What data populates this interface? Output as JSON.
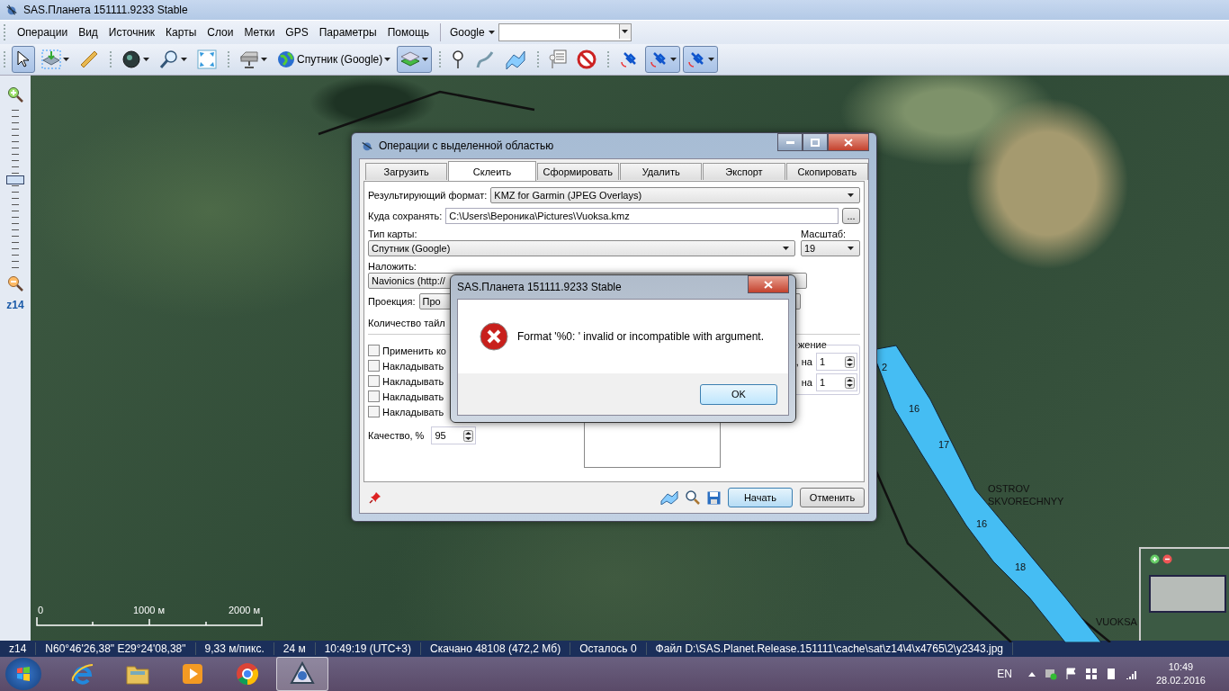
{
  "app_window": {
    "title": "SAS.Планета 151111.9233 Stable"
  },
  "menu": [
    "Операции",
    "Вид",
    "Источник",
    "Карты",
    "Слои",
    "Метки",
    "GPS",
    "Параметры",
    "Помощь"
  ],
  "search": {
    "provider": "Google"
  },
  "toolbar": {
    "groups": [
      [
        {
          "kind": "pointer",
          "selected": true,
          "dropdown": false
        },
        {
          "kind": "add-layer",
          "selected": false,
          "dropdown": true
        },
        {
          "kind": "ruler",
          "selected": false,
          "dropdown": false
        }
      ],
      [
        {
          "kind": "globe",
          "selected": false,
          "dropdown": true
        },
        {
          "kind": "magnifier",
          "selected": false,
          "dropdown": true
        },
        {
          "kind": "fullscreen",
          "selected": false,
          "dropdown": false
        }
      ],
      [
        {
          "kind": "drive",
          "selected": false,
          "dropdown": true
        },
        {
          "kind": "source",
          "label": "Спутник (Google)",
          "selected": false,
          "dropdown": true
        },
        {
          "kind": "layers",
          "selected": true,
          "dropdown": true
        }
      ],
      [
        {
          "kind": "pin",
          "selected": false,
          "dropdown": false
        },
        {
          "kind": "path",
          "selected": false,
          "dropdown": false
        },
        {
          "kind": "polygon",
          "selected": false,
          "dropdown": false
        }
      ],
      [
        {
          "kind": "marks-list",
          "selected": false,
          "dropdown": false
        },
        {
          "kind": "no-marks",
          "selected": false,
          "dropdown": false
        }
      ],
      [
        {
          "kind": "gps",
          "selected": false,
          "dropdown": false
        },
        {
          "kind": "gps",
          "selected": true,
          "dropdown": true
        },
        {
          "kind": "gps",
          "selected": true,
          "dropdown": true
        }
      ]
    ]
  },
  "zoom_bar": {
    "level": 0.55,
    "zoom_label": "z14"
  },
  "map": {
    "scale_labels": [
      "0",
      "1000 м",
      "2000 м"
    ],
    "place_labels": [
      "OSTROV SKVORECHNYY",
      "VUOKSA"
    ],
    "depth_marks": [
      "2",
      "16",
      "17",
      "16",
      "18"
    ]
  },
  "dialog": {
    "title": "Операции с выделенной областью",
    "tabs": [
      {
        "label": "Загрузить",
        "selected": false
      },
      {
        "label": "Склеить",
        "selected": true
      },
      {
        "label": "Сформировать",
        "selected": false
      },
      {
        "label": "Удалить",
        "selected": false
      },
      {
        "label": "Экспорт",
        "selected": false
      },
      {
        "label": "Скопировать",
        "selected": false
      }
    ],
    "format_label": "Результирующий формат:",
    "format_value": "KMZ for Garmin (JPEG Overlays)",
    "path_label": "Куда сохранять:",
    "path_value": "C:\\Users\\Вероника\\Pictures\\Vuoksa.kmz",
    "browse_button": "...",
    "map_type_label": "Тип карты:",
    "map_type_value": "Спутник (Google)",
    "scale_label": "Масштаб:",
    "scale_value": "19",
    "overlay_label": "Наложить:",
    "overlay_value": "Navionics (http://",
    "projection_label": "Проекция:",
    "projection_value": "Про",
    "tiles_label": "Количество тайл",
    "checkboxes": [
      {
        "label": "Применить ко",
        "checked": false
      },
      {
        "label": "Накладывать",
        "checked": false
      },
      {
        "label": "Накладывать",
        "checked": false
      },
      {
        "label": "Накладывать",
        "checked": false
      },
      {
        "label": "Накладывать",
        "checked": false
      }
    ],
    "quality_label": "Качество, %",
    "quality_value": "95",
    "split_group": {
      "title": "жение",
      "rows": [
        {
          "label": ", на",
          "value": "1"
        },
        {
          "label": "на",
          "value": "1"
        }
      ]
    },
    "start_button": "Начать",
    "cancel_button": "Отменить"
  },
  "message_box": {
    "title": "SAS.Планета 151111.9233 Stable",
    "text": "Format '%0: ' invalid or incompatible with argument.",
    "ok_button": "OK"
  },
  "status_bar": [
    "z14",
    "N60°46'26,38\" E29°24'08,38\"",
    "9,33 м/пикс.",
    "24 м",
    "10:49:19 (UTC+3)",
    "Скачано 48108 (472,2 Мб)",
    "Осталось 0",
    "Файл D:\\SAS.Planet.Release.151111\\cache\\sat\\z14\\4\\x4765\\2\\y2343.jpg"
  ],
  "taskbar": {
    "apps": [
      {
        "kind": "ie",
        "selected": false
      },
      {
        "kind": "folder",
        "selected": false
      },
      {
        "kind": "media",
        "selected": false
      },
      {
        "kind": "chrome",
        "selected": false
      },
      {
        "kind": "sas",
        "selected": true
      }
    ],
    "language": "EN",
    "time": "10:49",
    "date": "28.02.2016"
  }
}
